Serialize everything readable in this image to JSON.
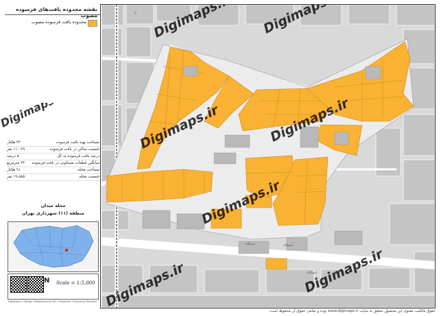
{
  "map": {
    "title": "نقشه محدوده بافت‌های فرسوده مصوب",
    "legend": [
      {
        "label": "محدوده بافت فرسوده مصوب",
        "color": "#F9B233"
      }
    ],
    "watermark": "Digimaps.ir",
    "stats": [
      {
        "label": "مساحت پهنه بافت فرسوده",
        "value": "۴۳ هکتار"
      },
      {
        "label": "جمعیت ساکن در بافت فرسوده",
        "value": "۱۱،۰۲۹ نفر"
      },
      {
        "label": "درصد بافت فرسوده به کل",
        "value": "۵ درصد"
      },
      {
        "label": "میانگین قطعات مسکونی در بافت فرسوده",
        "value": "۳۳ مترمربع"
      },
      {
        "label": "مساحت محله",
        "value": "۹۱ هکتار"
      },
      {
        "label": "جمعیت محله",
        "value": "۱۹،۸۵۵ نفر"
      }
    ],
    "locator_title": "محله میدان",
    "locator_subtitle": "منطقه (۱۱) شهرداری تهران",
    "scale": "Scale = 1:5,000",
    "north": "N",
    "credit": "Digimaps.ir | Design: Department of GIS | Projection: Transverse Mercator",
    "footer": "حقوق مالکیت معنوی این محصول متعلق به سایت www.digimaps.ir بوده و تمامی حقوق آن محفوظ است.",
    "colors": {
      "fabric": "#F9B233",
      "building": "#b9b9b9",
      "street": "#ffffff",
      "block": "#d8d8d8"
    }
  }
}
